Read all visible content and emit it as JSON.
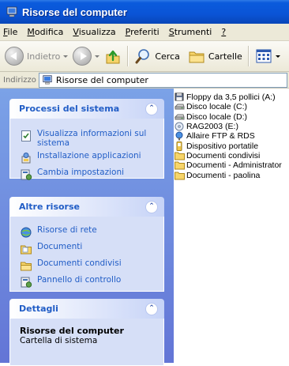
{
  "window": {
    "title": "Risorse del computer",
    "title_icon": "computer-icon"
  },
  "menubar": {
    "items": [
      {
        "first": "F",
        "rest": "ile"
      },
      {
        "first": "M",
        "rest": "odifica"
      },
      {
        "first": "V",
        "rest": "isualizza"
      },
      {
        "first": "P",
        "rest": "referiti"
      },
      {
        "first": "S",
        "rest": "trumenti"
      },
      {
        "first": "?",
        "rest": ""
      }
    ]
  },
  "toolbar": {
    "back_label": "Indietro",
    "search_label": "Cerca",
    "folders_label": "Cartelle"
  },
  "address": {
    "label": "Indirizzo",
    "value": "Risorse del computer"
  },
  "taskpane": {
    "system": {
      "title": "Processi del sistema",
      "items": [
        {
          "label": "Visualizza informazioni sul sistema",
          "icon": "system-info-icon"
        },
        {
          "label": "Installazione applicazioni",
          "icon": "add-remove-programs-icon"
        },
        {
          "label": "Cambia impostazioni",
          "icon": "control-panel-icon"
        }
      ]
    },
    "other": {
      "title": "Altre risorse",
      "items": [
        {
          "label": "Risorse di rete",
          "icon": "network-icon"
        },
        {
          "label": "Documenti",
          "icon": "documents-folder-icon"
        },
        {
          "label": "Documenti condivisi",
          "icon": "shared-folder-icon"
        },
        {
          "label": "Pannello di controllo",
          "icon": "control-panel-icon"
        }
      ]
    },
    "details": {
      "title": "Dettagli",
      "name": "Risorse del computer",
      "type": "Cartella di sistema"
    }
  },
  "content": {
    "items": [
      {
        "label": "Floppy da 3,5 pollici (A:)",
        "icon": "floppy-icon"
      },
      {
        "label": "Disco locale (C:)",
        "icon": "hard-drive-icon"
      },
      {
        "label": "Disco locale (D:)",
        "icon": "hard-drive-icon"
      },
      {
        "label": "RAG2003 (E:)",
        "icon": "cd-drive-icon"
      },
      {
        "label": "Allaire FTP & RDS",
        "icon": "ftp-icon"
      },
      {
        "label": "Dispositivo portatile",
        "icon": "portable-device-icon"
      },
      {
        "label": "Documenti condivisi",
        "icon": "folder-icon"
      },
      {
        "label": "Documenti - Administrator",
        "icon": "folder-icon"
      },
      {
        "label": "Documenti - paolina",
        "icon": "folder-icon"
      }
    ]
  }
}
